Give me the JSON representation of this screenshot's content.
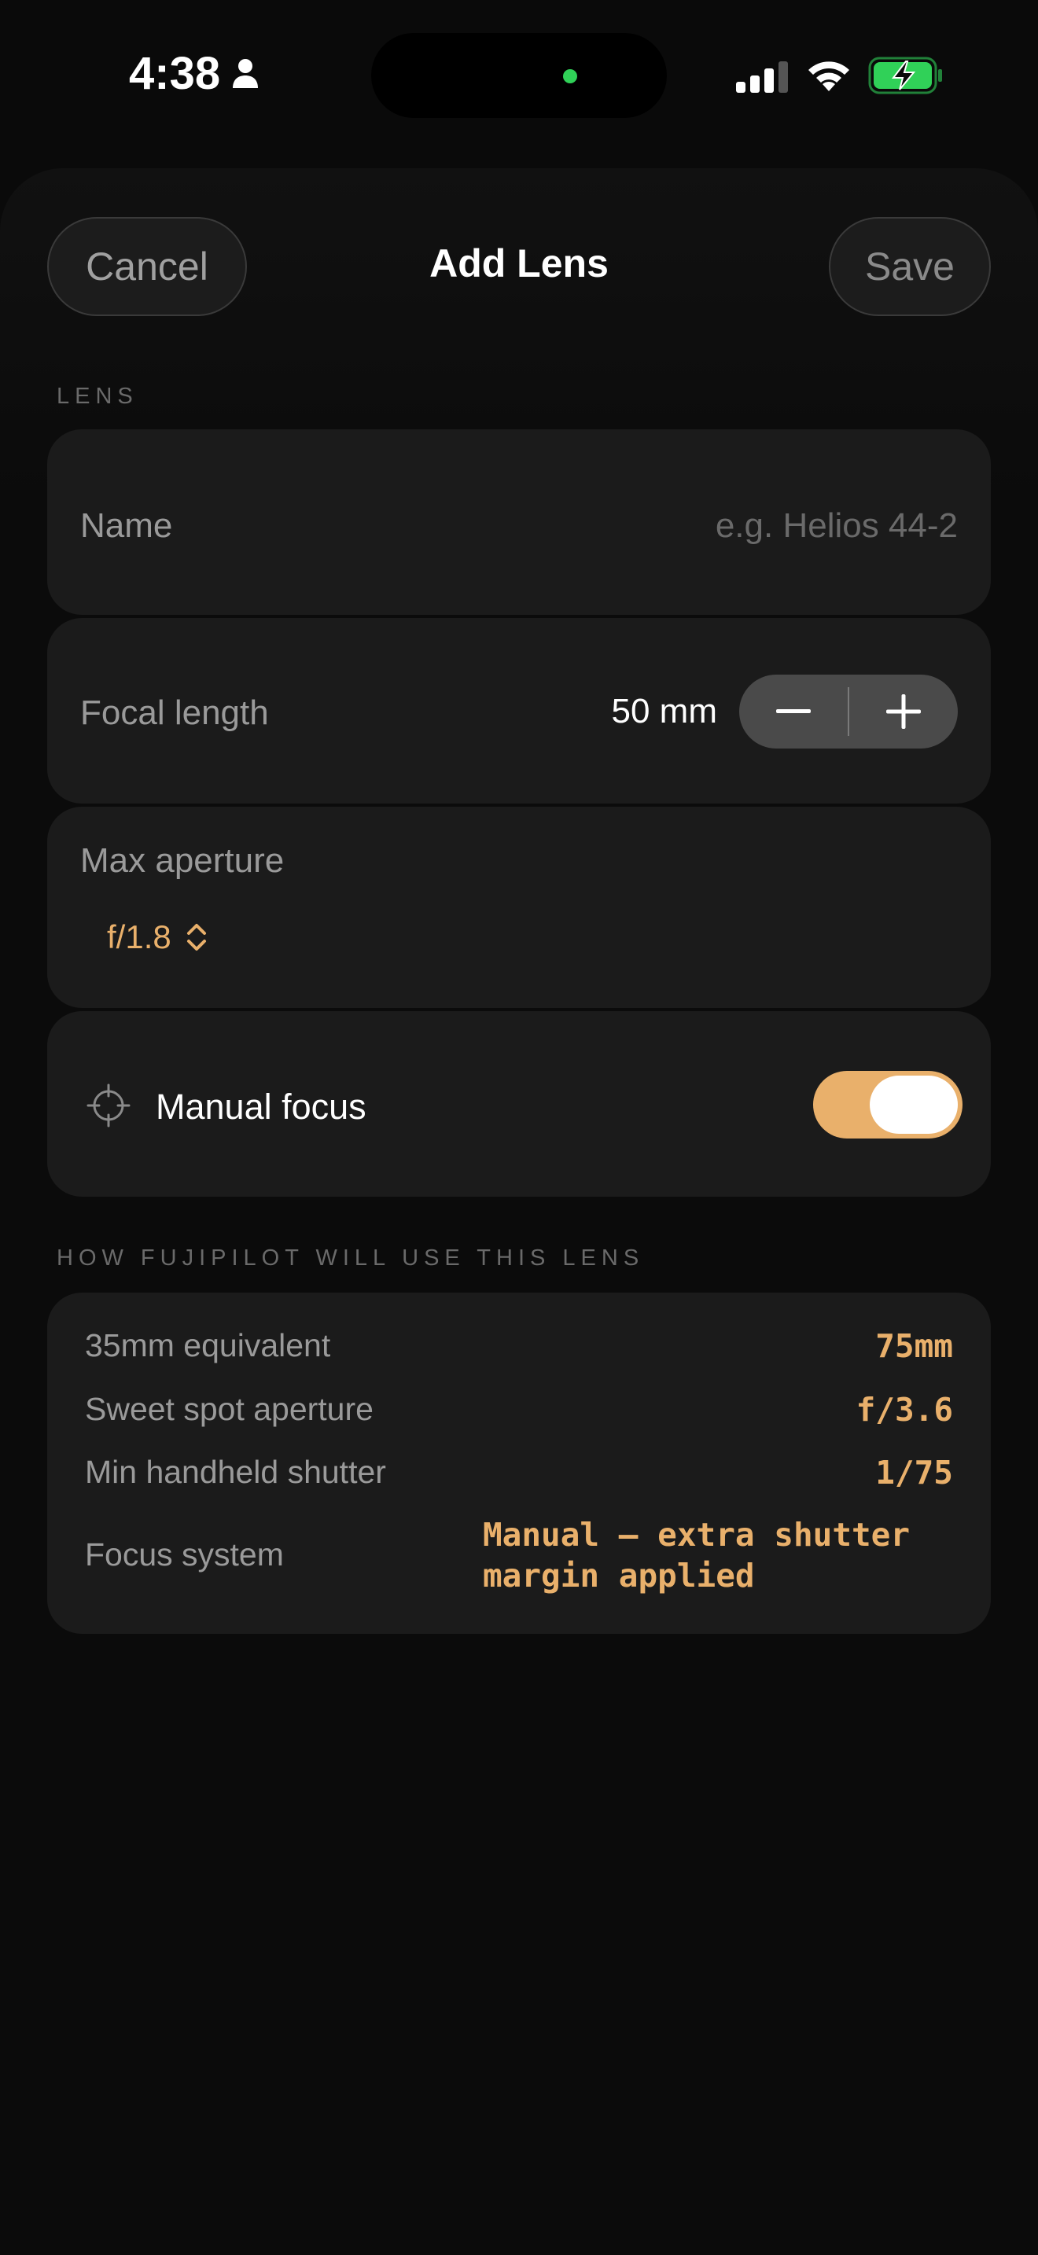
{
  "status_bar": {
    "time": "4:38",
    "icons": [
      "person-icon",
      "signal-icon",
      "wifi-icon",
      "battery-charging-icon"
    ],
    "battery_color": "#30d158"
  },
  "sheet": {
    "title": "Add Lens",
    "cancel_label": "Cancel",
    "save_label": "Save"
  },
  "lens_section": {
    "header": "LENS",
    "name_label": "Name",
    "name_placeholder": "e.g. Helios 44-2",
    "focal_label": "Focal length",
    "focal_value": "50 mm",
    "aperture_label": "Max aperture",
    "aperture_value": "f/1.8",
    "manual_focus_label": "Manual focus",
    "manual_focus_on": true
  },
  "usage_section": {
    "header": "HOW FUJIPILOT WILL USE THIS LENS",
    "rows": [
      {
        "label": "35mm equivalent",
        "value": "75mm"
      },
      {
        "label": "Sweet spot aperture",
        "value": "f/3.6"
      },
      {
        "label": "Min handheld shutter",
        "value": "1/75"
      },
      {
        "label": "Focus system",
        "value_line1": "Manual — extra shutter",
        "value_line2": "margin applied"
      }
    ]
  },
  "colors": {
    "accent": "#e9b06b",
    "card": "#1b1b1b",
    "background": "#0a0a0a"
  }
}
